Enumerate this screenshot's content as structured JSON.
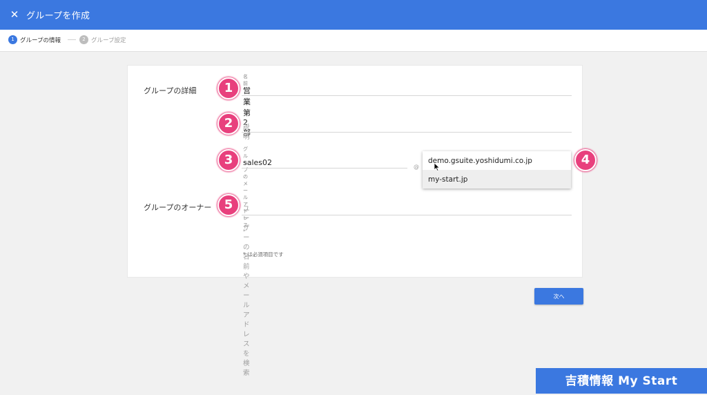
{
  "header": {
    "title": "グループを作成",
    "close_icon": "close-icon"
  },
  "steps": [
    {
      "num": "1",
      "label": "グループの情報"
    },
    {
      "num": "2",
      "label": "グループ設定"
    }
  ],
  "sections": {
    "details_label": "グループの詳細",
    "owner_label": "グループのオーナー"
  },
  "fields": {
    "name": {
      "label": "名前 *",
      "value": "営業第2部"
    },
    "description": {
      "placeholder": "説明"
    },
    "email": {
      "label": "グループのメールアドレス *",
      "value": "sales02",
      "at": "@"
    },
    "owner": {
      "placeholder": "ユーザーの名前やメールアドレスを検索"
    }
  },
  "domains": {
    "options": [
      "demo.gsuite.yoshidumi.co.jp",
      "my-start.jp"
    ]
  },
  "badges": [
    "1",
    "2",
    "3",
    "4",
    "5"
  ],
  "required_note": "* は必須項目です",
  "next_button": "次へ",
  "watermark": "吉積情報 My Start",
  "colors": {
    "accent": "#3b78e0",
    "badge": "#e8407d"
  }
}
